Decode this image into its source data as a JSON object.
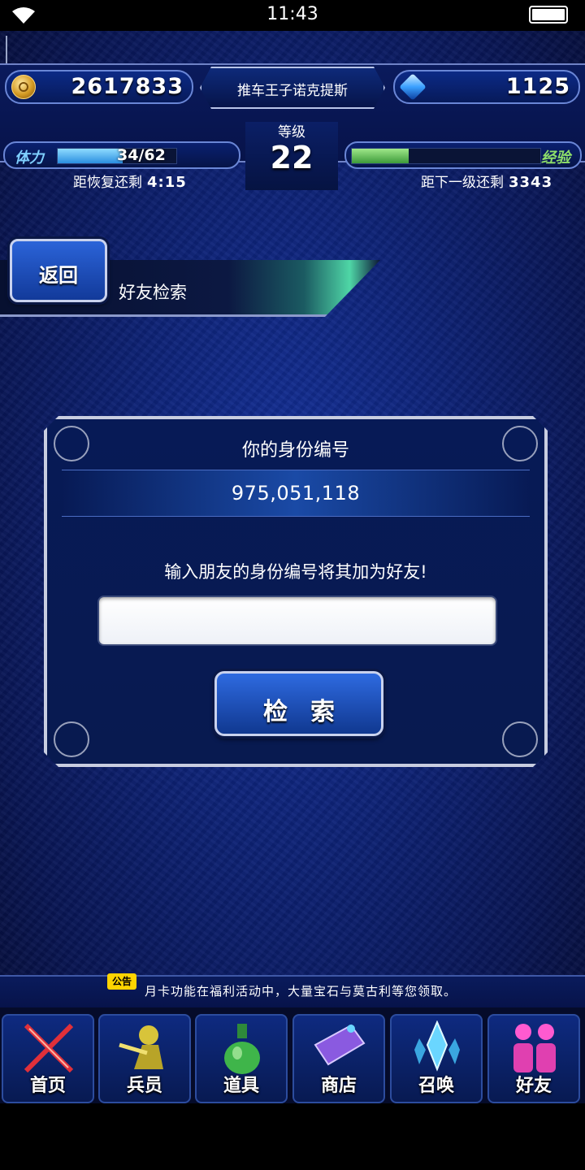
{
  "status_bar": {
    "time": "11:43"
  },
  "header": {
    "gil": "2617833",
    "gems": "1125",
    "player_name": "推车王子诺克提斯",
    "level_label": "等级",
    "level": "22",
    "stamina_label": "体力",
    "stamina_text": "34/62",
    "stamina_fraction": 0.548,
    "recovery_label": "距恢复还剩",
    "recovery_time": "4:15",
    "exp_label": "经验",
    "exp_fraction": 0.3,
    "next_level_label": "距下一级还剩",
    "next_level_value": "3343"
  },
  "page": {
    "back_label": "返回",
    "title": "好友检索"
  },
  "dialog": {
    "title": "你的身份编号",
    "id_value": "975,051,118",
    "hint": "输入朋友的身份编号将其加为好友!",
    "input_value": "",
    "search_label": "检索"
  },
  "notice": {
    "tag": "公告",
    "text": "月卡功能在福利活动中，大量宝石与莫古利等您领取。"
  },
  "nav": {
    "items": [
      {
        "label": "首页",
        "icon": "swords-icon",
        "color": "#e0303a"
      },
      {
        "label": "兵员",
        "icon": "warrior-icon",
        "color": "#d8c43a"
      },
      {
        "label": "道具",
        "icon": "potion-icon",
        "color": "#3fb54a"
      },
      {
        "label": "商店",
        "icon": "shop-icon",
        "color": "#8a5ae0"
      },
      {
        "label": "召唤",
        "icon": "crystal-icon",
        "color": "#6ad6ff"
      },
      {
        "label": "好友",
        "icon": "friends-icon",
        "color": "#ff5ad0"
      }
    ]
  }
}
